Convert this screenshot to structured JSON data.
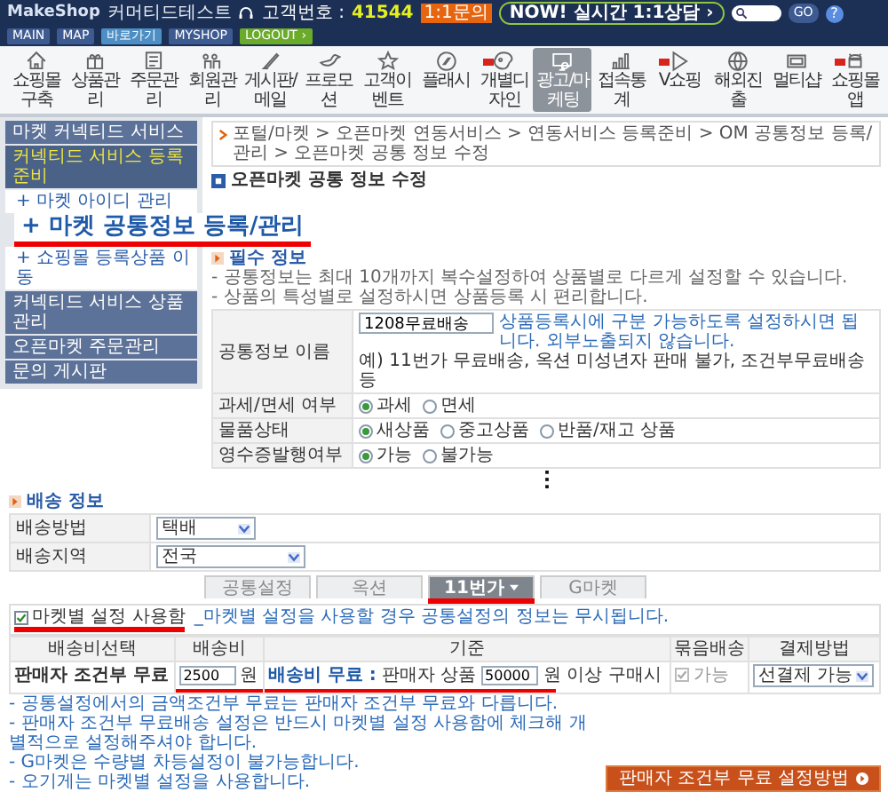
{
  "top_bar": {
    "logo": "MakeShop",
    "shop_name": "커머티드테스트",
    "customer_label": "고객번호 :",
    "customer_number": "41544",
    "inquiry": "1:1문의",
    "live_chat": "NOW! 실시간 1:1상담 ›",
    "search_button": "GO",
    "help": "?",
    "links": [
      {
        "label": "MAIN",
        "color": "#3d5a91"
      },
      {
        "label": "MAP",
        "color": "#3d5a91"
      },
      {
        "label": "바로가기",
        "color": "#4d8fc4"
      },
      {
        "label": "MYSHOP",
        "color": "#3d5a91"
      },
      {
        "label": "LOGOUT ›",
        "color": "#6bab2a"
      }
    ]
  },
  "main_menu": [
    {
      "label": "쇼핑몰구축",
      "selected": false,
      "new": false
    },
    {
      "label": "상품관리",
      "selected": false,
      "new": false
    },
    {
      "label": "주문관리",
      "selected": false,
      "new": false
    },
    {
      "label": "회원관리",
      "selected": false,
      "new": false
    },
    {
      "label": "게시판/메일",
      "selected": false,
      "new": false
    },
    {
      "label": "프로모션",
      "selected": false,
      "new": false
    },
    {
      "label": "고객이벤트",
      "selected": false,
      "new": false
    },
    {
      "label": "플래시",
      "selected": false,
      "new": false
    },
    {
      "label": "개별디자인",
      "selected": false,
      "new": true
    },
    {
      "label": "광고/마케팅",
      "selected": true,
      "new": false
    },
    {
      "label": "접속통계",
      "selected": false,
      "new": false
    },
    {
      "label": "V쇼핑",
      "selected": false,
      "new": true
    },
    {
      "label": "해외진출",
      "selected": false,
      "new": false
    },
    {
      "label": "멀티샵",
      "selected": false,
      "new": false
    },
    {
      "label": "쇼핑몰앱",
      "selected": false,
      "new": true
    }
  ],
  "sidebar_upper": [
    {
      "label": "마켓 커넥티드 서비스",
      "kind": "group",
      "selected": false
    },
    {
      "label": "커넥티드 서비스 등록준비",
      "kind": "group",
      "selected": true
    },
    {
      "label": "+ 마켓 아이디 관리",
      "kind": "subitem",
      "selected": false
    }
  ],
  "callout": "+ 마켓 공통정보 등록/관리",
  "sidebar_lower": [
    {
      "label": "+ 쇼핑몰 등록상품 이동",
      "kind": "subitem",
      "selected": false
    },
    {
      "label": "커넥티드 서비스 상품관리",
      "kind": "group",
      "selected": false
    },
    {
      "label": "오픈마켓 주문관리",
      "kind": "group",
      "selected": false
    },
    {
      "label": "문의 게시판",
      "kind": "group",
      "selected": false
    }
  ],
  "breadcrumb": "포털/마켓 > 오픈마켓 연동서비스 > 연동서비스 등록준비 > OM 공통정보 등록/관리 > 오픈마켓 공통 정보 수정",
  "page_title": "오픈마켓 공통 정보 수정",
  "required_info": {
    "heading": "필수 정보",
    "notes": [
      "- 공통정보는 최대 10개까지 복수설정하여 상품별로 다르게 설정할 수 있습니다.",
      "- 상품의 특성별로 설정하시면 상품등록 시 편리합니다."
    ],
    "rows": [
      {
        "label": "공통정보 이름",
        "kind": "text_input",
        "value": "1208무료배송",
        "hint": "상품등록시에 구분 가능하도록 설정하시면 됩니다. 외부노출되지 않습니다.",
        "example": "예) 11번가 무료배송, 옥션 미성년자 판매 불가, 조건부무료배송 등"
      },
      {
        "label": "과세/면세 여부",
        "kind": "radio",
        "options": [
          {
            "label": "과세",
            "selected": true
          },
          {
            "label": "면세",
            "selected": false
          }
        ]
      },
      {
        "label": "물품상태",
        "kind": "radio",
        "options": [
          {
            "label": "새상품",
            "selected": true
          },
          {
            "label": "중고상품",
            "selected": false
          },
          {
            "label": "반품/재고 상품",
            "selected": false
          }
        ]
      },
      {
        "label": "영수증발행여부",
        "kind": "radio",
        "options": [
          {
            "label": "가능",
            "selected": true
          },
          {
            "label": "불가능",
            "selected": false
          }
        ]
      }
    ]
  },
  "shipping_info": {
    "heading": "배송 정보",
    "rows": [
      {
        "label": "배송방법",
        "value": "택배"
      },
      {
        "label": "배송지역",
        "value": "전국"
      }
    ]
  },
  "market_tabs": [
    {
      "label": "공통설정",
      "selected": false
    },
    {
      "label": "옥션",
      "selected": false
    },
    {
      "label": "11번가",
      "selected": true
    },
    {
      "label": "G마켓",
      "selected": false
    }
  ],
  "market_setting": {
    "label": "마켓별 설정 사용함",
    "checked": true,
    "note": "_마켓별 설정을 사용할 경우 공통설정의 정보는 무시됩니다."
  },
  "fee_table": {
    "columns": [
      "배송비선택",
      "배송비",
      "기준",
      "묶음배송",
      "결제방법"
    ],
    "row": {
      "type": "판매자 조건부 무료",
      "fee": "2500",
      "fee_unit": "원",
      "basis_label": "배송비 무료 :",
      "basis_prefix": "판매자 상품",
      "threshold": "50000",
      "basis_suffix": "원 이상 구매시",
      "bundle_label": "가능",
      "bundle_checked": true,
      "bundle_disabled": true,
      "payment": "선결제 가능"
    }
  },
  "notes": [
    "- 공통설정에서의 금액조건부 무료는 판매자 조건부 무료와 다릅니다.",
    "- 판매자 조건부 무료배송 설정은 반드시 마켓별 설정 사용함에 체크해 개별적으로 설정해주셔야 합니다.",
    "- G마켓은 수량별 차등설정이 불가능합니다.",
    "- 오기게는 마켓별 설정을 사용합니다."
  ],
  "guide_button": "판매자 조건부 무료 설정방법"
}
